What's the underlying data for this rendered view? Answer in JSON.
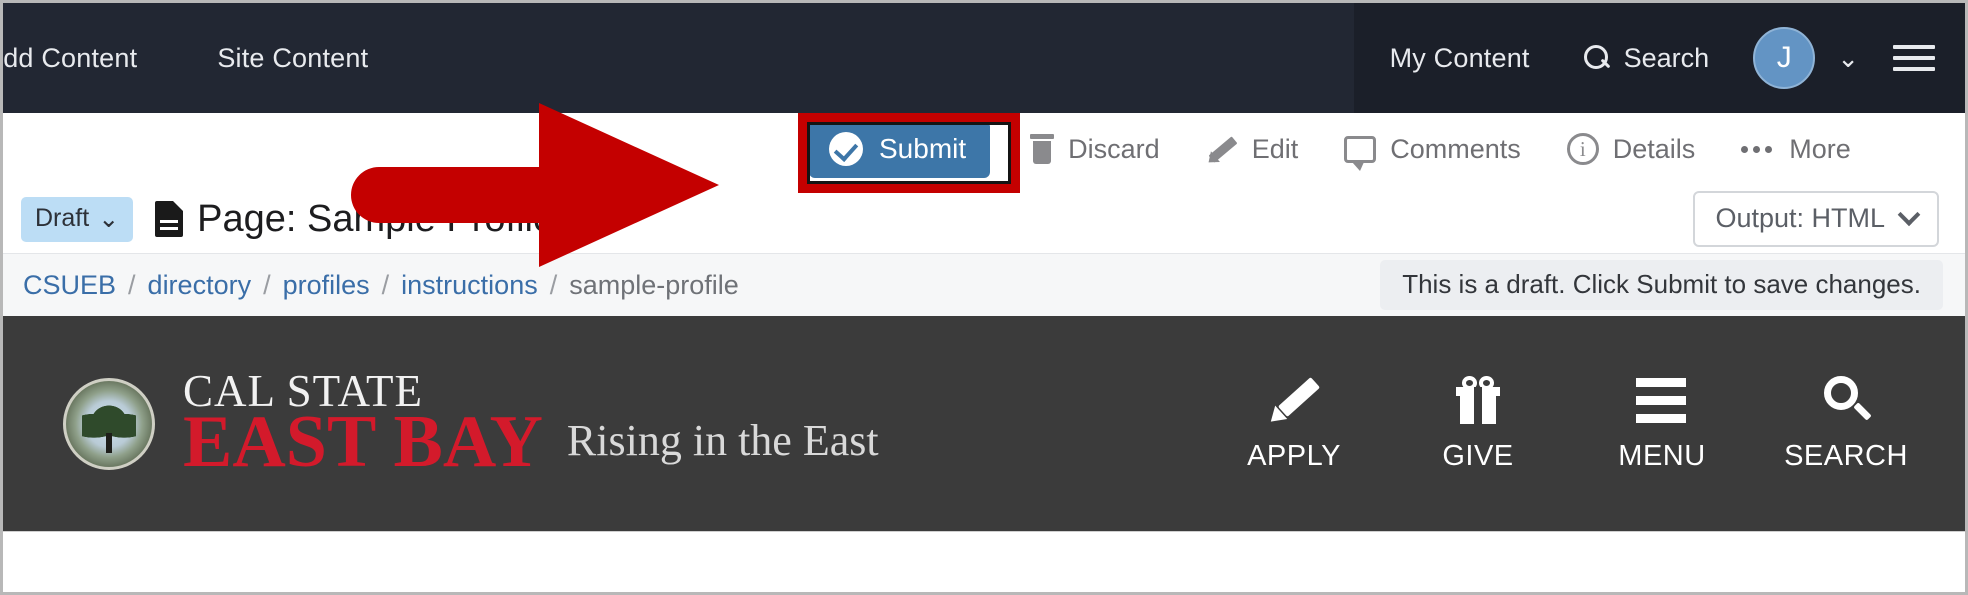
{
  "top_nav": {
    "left_items": [
      {
        "label": "Add Content",
        "name": "nav-add-content"
      },
      {
        "label": "Site Content",
        "name": "nav-site-content"
      }
    ],
    "my_content_label": "My Content",
    "search_label": "Search",
    "search_icon": "search-icon",
    "avatar_initial": "J",
    "avatar_chevron": "⌄",
    "hamburger_icon": "hamburger-icon",
    "bg_color": "#222733",
    "bg_color_right": "#1b1f29",
    "avatar_color": "#6394c4"
  },
  "cms_toolbar": {
    "submit_label": "Submit",
    "submit_icon": "check-circle-icon",
    "submit_color": "#3d76a8",
    "highlight_color": "#c40000",
    "items": [
      {
        "label": "Discard",
        "icon": "trash-icon"
      },
      {
        "label": "Edit",
        "icon": "pencil-icon"
      },
      {
        "label": "Comments",
        "icon": "comment-bubble-icon"
      },
      {
        "label": "Details",
        "icon": "info-circle-icon"
      },
      {
        "label": "More",
        "icon": "ellipsis-icon"
      }
    ],
    "details_glyph": "i"
  },
  "title_row": {
    "status_badge": "Draft",
    "status_chevron": "⌄",
    "status_badge_color": "#bcddf5",
    "doc_icon": "document-icon",
    "title": "Page: Sample Profile",
    "output_label": "Output: HTML"
  },
  "breadcrumb_row": {
    "crumbs": [
      {
        "label": "CSUEB",
        "link": true
      },
      {
        "label": "directory",
        "link": true
      },
      {
        "label": "profiles",
        "link": true
      },
      {
        "label": "instructions",
        "link": true
      },
      {
        "label": "sample-profile",
        "link": false
      }
    ],
    "separator": "/",
    "link_color": "#3a6ea8",
    "draft_notice": "This is a draft. Click Submit to save changes."
  },
  "site_header": {
    "seal_icon": "university-seal-icon",
    "wordmark_line1": "CAL STATE",
    "wordmark_line2": "EAST BAY",
    "tagline": "Rising in the East",
    "wordmark_red": "#d31a2b",
    "bg_color": "#3b3b3b",
    "actions": [
      {
        "label": "APPLY",
        "icon": "pencil-icon"
      },
      {
        "label": "GIVE",
        "icon": "gift-icon"
      },
      {
        "label": "MENU",
        "icon": "hamburger-icon"
      },
      {
        "label": "SEARCH",
        "icon": "search-icon"
      }
    ]
  },
  "annotation": {
    "arrow_icon": "red-arrow-pointer",
    "arrow_color": "#c40000"
  }
}
